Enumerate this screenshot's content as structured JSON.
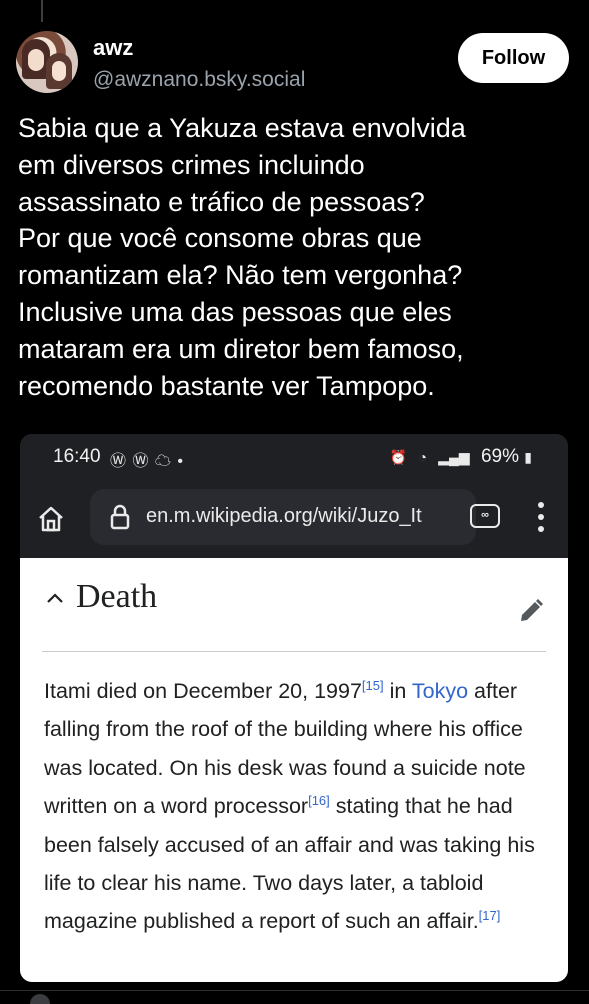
{
  "post": {
    "author": {
      "display_name": "awz",
      "handle": "@awznano.bsky.social",
      "avatar_icon": "anime-avatar"
    },
    "follow_label": "Follow",
    "text": [
      "Sabia que a Yakuza estava envolvida",
      "em diversos crimes incluindo",
      "assassinato e tráfico de pessoas?",
      "Por que você consome obras que",
      "romantizam ela? Não tem vergonha?",
      "Inclusive uma das pessoas que eles",
      "mataram era um diretor bem famoso,",
      "recomendo bastante ver Tampopo."
    ]
  },
  "screenshot": {
    "status_bar": {
      "time": "16:40",
      "left_icons": "Ⓦ Ⓦ ☁ •",
      "battery": "69%"
    },
    "browser": {
      "url": "en.m.wikipedia.org/wiki/Juzo_It",
      "tabs_count": "∞"
    },
    "article": {
      "section_heading": "Death",
      "text_1": "Itami died on December 20, 1997",
      "ref_15": "[15]",
      "text_2": " in ",
      "link_tokyo": "Tokyo",
      "text_3": " after falling from the roof of the building where his office was located. On his desk was found a suicide note written on a word processor",
      "ref_16": "[16]",
      "text_4": " stating that he had been falsely accused of an affair and was taking his life to clear his name. Two days later, a tabloid magazine published a report of such an affair.",
      "ref_17": "[17]"
    }
  },
  "colors": {
    "background": "#000000",
    "link": "#3366cc",
    "handle": "#9aa3ab"
  }
}
